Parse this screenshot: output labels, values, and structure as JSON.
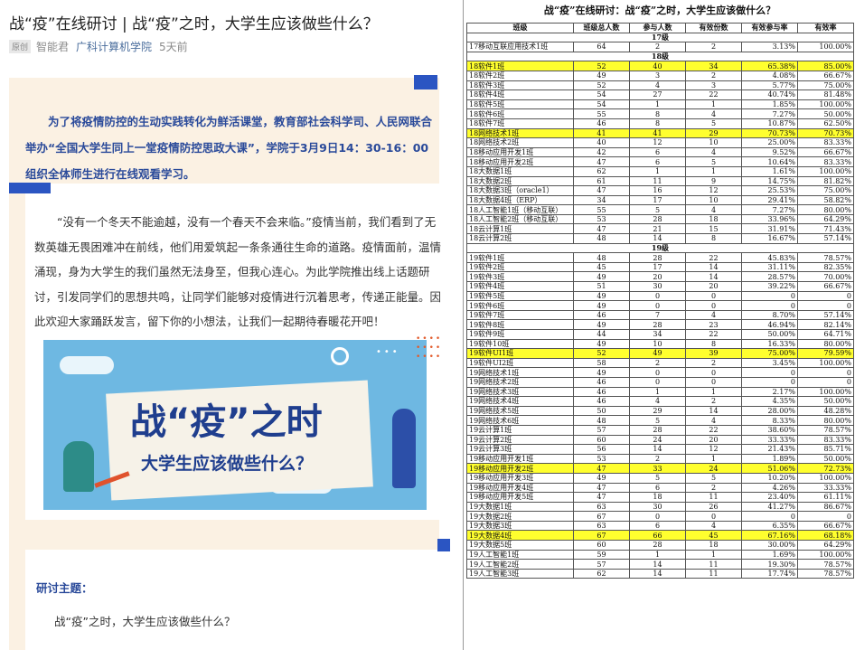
{
  "article": {
    "title": "战“疫”在线研讨 | 战“疫”之时，大学生应该做些什么？",
    "meta": {
      "original_badge": "原创",
      "author": "智能君",
      "source": "广科计算机学院",
      "time": "5天前"
    },
    "notice": "为了将疫情防控的生动实践转化为鲜活课堂，教育部社会科学司、人民网联合举办“全国大学生同上一堂疫情防控思政大课”，学院于3月9日14：30-16：00组织全体师生进行在线观看学习。",
    "paragraph": "“没有一个冬天不能逾越，没有一个春天不会来临。”疫情当前，我们看到了无数英雄无畏困难冲在前线，他们用爱筑起一条条通往生命的道路。疫情面前，温情涌现，身为大学生的我们虽然无法身至，但我心连心。为此学院推出线上话题研讨，引发同学们的思想共鸣，让同学们能够对疫情进行沉着思考，传递正能量。因此欢迎大家踊跃发言，留下你的小想法，让我们一起期待春暖花开吧！",
    "banner": {
      "title": "战“疫”之时",
      "subtitle": "大学生应该做些什么？"
    },
    "topic_label": "研讨主题：",
    "topic": "战“疫”之时，大学生应该做些什么？"
  },
  "table": {
    "title": "战“疫”在线研讨：战“疫”之时，大学生应该做什么？",
    "headers": [
      "班级",
      "班级总人数",
      "参与人数",
      "有效份数",
      "有效参与率",
      "有效率"
    ],
    "groups": [
      {
        "label": "17级",
        "rows": [
          {
            "cells": [
              "17移动互联应用技术1班",
              "64",
              "2",
              "2",
              "3.13%",
              "100.00%"
            ],
            "highlight": false
          }
        ]
      },
      {
        "label": "18级",
        "rows": [
          {
            "cells": [
              "18软件1班",
              "52",
              "40",
              "34",
              "65.38%",
              "85.00%"
            ],
            "highlight": true
          },
          {
            "cells": [
              "18软件2班",
              "49",
              "3",
              "2",
              "4.08%",
              "66.67%"
            ],
            "highlight": false
          },
          {
            "cells": [
              "18软件3班",
              "52",
              "4",
              "3",
              "5.77%",
              "75.00%"
            ],
            "highlight": false
          },
          {
            "cells": [
              "18软件4班",
              "54",
              "27",
              "22",
              "40.74%",
              "81.48%"
            ],
            "highlight": false
          },
          {
            "cells": [
              "18软件5班",
              "54",
              "1",
              "1",
              "1.85%",
              "100.00%"
            ],
            "highlight": false
          },
          {
            "cells": [
              "18软件6班",
              "55",
              "8",
              "4",
              "7.27%",
              "50.00%"
            ],
            "highlight": false
          },
          {
            "cells": [
              "18软件7班",
              "46",
              "8",
              "5",
              "10.87%",
              "62.50%"
            ],
            "highlight": false
          },
          {
            "cells": [
              "18网络技术1班",
              "41",
              "41",
              "29",
              "70.73%",
              "70.73%"
            ],
            "highlight": true
          },
          {
            "cells": [
              "18网络技术2班",
              "40",
              "12",
              "10",
              "25.00%",
              "83.33%"
            ],
            "highlight": false
          },
          {
            "cells": [
              "18移动应用开发1班",
              "42",
              "6",
              "4",
              "9.52%",
              "66.67%"
            ],
            "highlight": false
          },
          {
            "cells": [
              "18移动应用开发2班",
              "47",
              "6",
              "5",
              "10.64%",
              "83.33%"
            ],
            "highlight": false
          },
          {
            "cells": [
              "18大数据1班",
              "62",
              "1",
              "1",
              "1.61%",
              "100.00%"
            ],
            "highlight": false
          },
          {
            "cells": [
              "18大数据2班",
              "61",
              "11",
              "9",
              "14.75%",
              "81.82%"
            ],
            "highlight": false
          },
          {
            "cells": [
              "18大数据3班（oracle1）",
              "47",
              "16",
              "12",
              "25.53%",
              "75.00%"
            ],
            "highlight": false
          },
          {
            "cells": [
              "18大数据4班（ERP）",
              "34",
              "17",
              "10",
              "29.41%",
              "58.82%"
            ],
            "highlight": false
          },
          {
            "cells": [
              "18人工智能1班（移动互联）",
              "55",
              "5",
              "4",
              "7.27%",
              "80.00%"
            ],
            "highlight": false
          },
          {
            "cells": [
              "18人工智能2班（移动互联）",
              "53",
              "28",
              "18",
              "33.96%",
              "64.29%"
            ],
            "highlight": false
          },
          {
            "cells": [
              "18云计算1班",
              "47",
              "21",
              "15",
              "31.91%",
              "71.43%"
            ],
            "highlight": false
          },
          {
            "cells": [
              "18云计算2班",
              "48",
              "14",
              "8",
              "16.67%",
              "57.14%"
            ],
            "highlight": false
          }
        ]
      },
      {
        "label": "19级",
        "rows": [
          {
            "cells": [
              "19软件1班",
              "48",
              "28",
              "22",
              "45.83%",
              "78.57%"
            ],
            "highlight": false
          },
          {
            "cells": [
              "19软件2班",
              "45",
              "17",
              "14",
              "31.11%",
              "82.35%"
            ],
            "highlight": false
          },
          {
            "cells": [
              "19软件3班",
              "49",
              "20",
              "14",
              "28.57%",
              "70.00%"
            ],
            "highlight": false
          },
          {
            "cells": [
              "19软件4班",
              "51",
              "30",
              "20",
              "39.22%",
              "66.67%"
            ],
            "highlight": false
          },
          {
            "cells": [
              "19软件5班",
              "49",
              "0",
              "0",
              "0",
              "0"
            ],
            "highlight": false
          },
          {
            "cells": [
              "19软件6班",
              "49",
              "0",
              "0",
              "0",
              "0"
            ],
            "highlight": false
          },
          {
            "cells": [
              "19软件7班",
              "46",
              "7",
              "4",
              "8.70%",
              "57.14%"
            ],
            "highlight": false
          },
          {
            "cells": [
              "19软件8班",
              "49",
              "28",
              "23",
              "46.94%",
              "82.14%"
            ],
            "highlight": false
          },
          {
            "cells": [
              "19软件9班",
              "44",
              "34",
              "22",
              "50.00%",
              "64.71%"
            ],
            "highlight": false
          },
          {
            "cells": [
              "19软件10班",
              "49",
              "10",
              "8",
              "16.33%",
              "80.00%"
            ],
            "highlight": false
          },
          {
            "cells": [
              "19软件UI1班",
              "52",
              "49",
              "39",
              "75.00%",
              "79.59%"
            ],
            "highlight": true
          },
          {
            "cells": [
              "19软件UI2班",
              "58",
              "2",
              "2",
              "3.45%",
              "100.00%"
            ],
            "highlight": false
          },
          {
            "cells": [
              "19网络技术1班",
              "49",
              "0",
              "0",
              "0",
              "0"
            ],
            "highlight": false
          },
          {
            "cells": [
              "19网络技术2班",
              "46",
              "0",
              "0",
              "0",
              "0"
            ],
            "highlight": false
          },
          {
            "cells": [
              "19网络技术3班",
              "46",
              "1",
              "1",
              "2.17%",
              "100.00%"
            ],
            "highlight": false
          },
          {
            "cells": [
              "19网络技术4班",
              "46",
              "4",
              "2",
              "4.35%",
              "50.00%"
            ],
            "highlight": false
          },
          {
            "cells": [
              "19网络技术5班",
              "50",
              "29",
              "14",
              "28.00%",
              "48.28%"
            ],
            "highlight": false
          },
          {
            "cells": [
              "19网络技术6班",
              "48",
              "5",
              "4",
              "8.33%",
              "80.00%"
            ],
            "highlight": false
          },
          {
            "cells": [
              "19云计算1班",
              "57",
              "28",
              "22",
              "38.60%",
              "78.57%"
            ],
            "highlight": false
          },
          {
            "cells": [
              "19云计算2班",
              "60",
              "24",
              "20",
              "33.33%",
              "83.33%"
            ],
            "highlight": false
          },
          {
            "cells": [
              "19云计算3班",
              "56",
              "14",
              "12",
              "21.43%",
              "85.71%"
            ],
            "highlight": false
          },
          {
            "cells": [
              "19移动应用开发1班",
              "53",
              "2",
              "1",
              "1.89%",
              "50.00%"
            ],
            "highlight": false
          },
          {
            "cells": [
              "19移动应用开发2班",
              "47",
              "33",
              "24",
              "51.06%",
              "72.73%"
            ],
            "highlight": true
          },
          {
            "cells": [
              "19移动应用开发3班",
              "49",
              "5",
              "5",
              "10.20%",
              "100.00%"
            ],
            "highlight": false
          },
          {
            "cells": [
              "19移动应用开发4班",
              "47",
              "6",
              "2",
              "4.26%",
              "33.33%"
            ],
            "highlight": false
          },
          {
            "cells": [
              "19移动应用开发5班",
              "47",
              "18",
              "11",
              "23.40%",
              "61.11%"
            ],
            "highlight": false
          },
          {
            "cells": [
              "19大数据1班",
              "63",
              "30",
              "26",
              "41.27%",
              "86.67%"
            ],
            "highlight": false
          },
          {
            "cells": [
              "19大数据2班",
              "67",
              "0",
              "0",
              "0",
              "0"
            ],
            "highlight": false
          },
          {
            "cells": [
              "19大数据3班",
              "63",
              "6",
              "4",
              "6.35%",
              "66.67%"
            ],
            "highlight": false
          },
          {
            "cells": [
              "19大数据4班",
              "67",
              "66",
              "45",
              "67.16%",
              "68.18%"
            ],
            "highlight": true
          },
          {
            "cells": [
              "19大数据5班",
              "60",
              "28",
              "18",
              "30.00%",
              "64.29%"
            ],
            "highlight": false
          },
          {
            "cells": [
              "19人工智能1班",
              "59",
              "1",
              "1",
              "1.69%",
              "100.00%"
            ],
            "highlight": false
          },
          {
            "cells": [
              "19人工智能2班",
              "57",
              "14",
              "11",
              "19.30%",
              "78.57%"
            ],
            "highlight": false
          },
          {
            "cells": [
              "19人工智能3班",
              "62",
              "14",
              "11",
              "17.74%",
              "78.57%"
            ],
            "highlight": false
          }
        ]
      }
    ]
  },
  "colors": {
    "accent_blue": "#2b55c2",
    "notice_text": "#2a4a9a",
    "highlight": "#ffff2e",
    "panel_bg": "#fbf1e3"
  },
  "icons": {
    "banner_clock": "clock-icon"
  }
}
